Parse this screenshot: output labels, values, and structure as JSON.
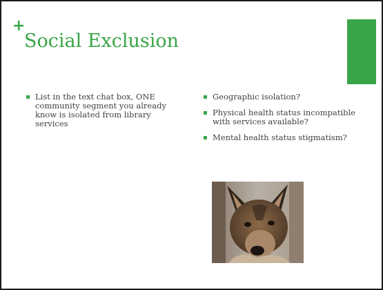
{
  "slide": {
    "plus_mark": "+",
    "title": "Social Exclusion",
    "accent_color": "#3aa548",
    "left_bullets": [
      "List in the text chat box, ONE community segment you already know is isolated from library services"
    ],
    "right_bullets": [
      "Geographic isolation?",
      "Physical health status incompatible with services available?",
      "Mental health status stigmatism?"
    ],
    "photo": {
      "subject": "dog",
      "icon": "dog-photo"
    }
  }
}
